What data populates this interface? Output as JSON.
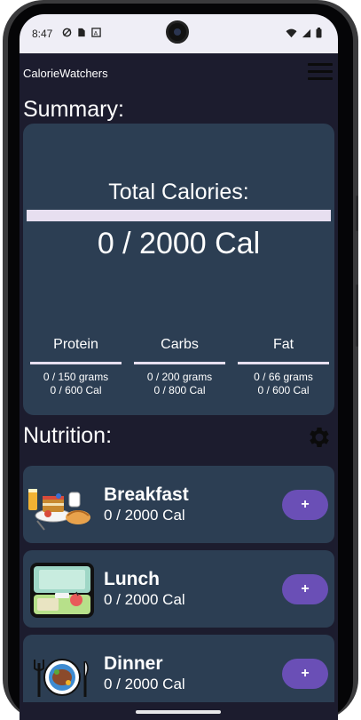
{
  "status_bar": {
    "time": "8:47",
    "icons_left": [
      "data-saver-icon",
      "sim-card-icon",
      "translate-icon"
    ],
    "icons_right": [
      "wifi-icon",
      "signal-icon",
      "battery-icon"
    ]
  },
  "app": {
    "title": "CalorieWatchers",
    "menu_icon": "hamburger-menu-icon"
  },
  "summary": {
    "heading": "Summary:",
    "total_label": "Total Calories:",
    "total_value": "0 / 2000 Cal",
    "total_progress": 0,
    "macros": [
      {
        "name": "Protein",
        "grams": "0 / 150 grams",
        "cal": "0 / 600 Cal",
        "progress": 0
      },
      {
        "name": "Carbs",
        "grams": "0 / 200 grams",
        "cal": "0 / 800 Cal",
        "progress": 0
      },
      {
        "name": "Fat",
        "grams": "0 / 66 grams",
        "cal": "0 / 600 Cal",
        "progress": 0
      }
    ]
  },
  "nutrition": {
    "heading": "Nutrition:",
    "settings_icon": "gear-icon",
    "meals": [
      {
        "name": "Breakfast",
        "cal": "0 / 2000 Cal",
        "image": "breakfast-food-image",
        "add_label": "+"
      },
      {
        "name": "Lunch",
        "cal": "0 / 2000 Cal",
        "image": "lunchbox-image",
        "add_label": "+"
      },
      {
        "name": "Dinner",
        "cal": "0 / 2000 Cal",
        "image": "dinner-plate-image",
        "add_label": "+"
      }
    ]
  },
  "colors": {
    "background": "#1c1c2e",
    "card": "#2c3e53",
    "accent": "#6a4fb6",
    "track": "#e7dff0"
  }
}
